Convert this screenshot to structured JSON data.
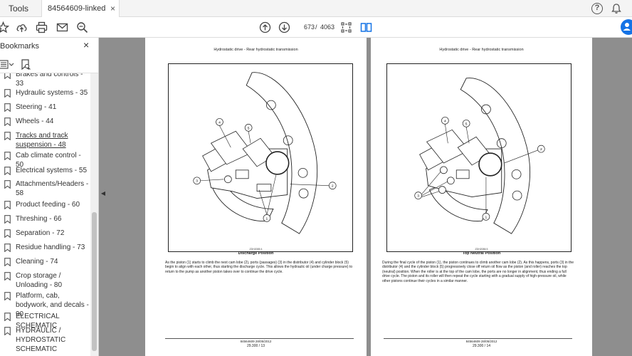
{
  "tabs": {
    "tools": "Tools",
    "document": "84564609-linked pd...",
    "close": "×"
  },
  "toolbar": {
    "current_page": "673",
    "separator": "/",
    "total_pages": "4063"
  },
  "sidebar": {
    "title": "Bookmarks",
    "close": "×",
    "items": [
      {
        "label": "Brakes and controls - 33"
      },
      {
        "label": "Hydraulic systems - 35"
      },
      {
        "label": "Steering - 41"
      },
      {
        "label": "Wheels - 44"
      },
      {
        "label": "Tracks and track suspension - 48"
      },
      {
        "label": "Cab climate control - 50"
      },
      {
        "label": "Electrical systems - 55"
      },
      {
        "label": "Attachments/Headers - 58"
      },
      {
        "label": "Product feeding - 60"
      },
      {
        "label": "Threshing - 66"
      },
      {
        "label": "Separation - 72"
      },
      {
        "label": "Residue handling - 73"
      },
      {
        "label": "Cleaning - 74"
      },
      {
        "label": "Crop storage / Unloading - 80"
      },
      {
        "label": "Platform, cab, bodywork, and decals - 90"
      },
      {
        "label": "ELECTRICAL SCHEMATIC"
      },
      {
        "label": "HYDRAULIC / HYDROSTATIC SCHEMATIC"
      }
    ]
  },
  "pages": [
    {
      "header": "Hydrostatic drive - Rear hydrostatic transmission",
      "fig_small": "ZDH2085 4",
      "caption": "Discharge Position",
      "body": "As the piston (1) starts to climb the next cam lobe (2), ports (passages) (3) in the distributor (4) and cylinder block (5) begin to align with each other, thus starting the discharge cycle. This allows the hydraulic oil (under charge pressure) to return to the pump as another piston takes over to continue the drive cycle.",
      "footer_ref": "84564609 28/05/2012",
      "footer_page": "29.300 / 13",
      "callouts": [
        "1",
        "2",
        "3",
        "4",
        "5"
      ]
    },
    {
      "header": "Hydrostatic drive - Rear hydrostatic transmission",
      "fig_small": "ZDH2086 5",
      "caption": "Top Neutral Position",
      "body": "During the final cycle of the piston (1), the piston continues to climb another cam lobe (2). As this happens, ports (3) in the distributor (4) and the cylinder block (5) progressively close off return oil flow as the piston (and roller) reaches the top (neutral) position. When the roller is at the top of the cam lobe, the ports are no longer in alignment, thus ending a full drive cycle. The piston and its roller will then repeat the cycle starting with a gradual supply of high-pressure oil, while other pistons continue their cycles in a similar manner.",
      "footer_ref": "84564609 28/05/2012",
      "footer_page": "29.300 / 14",
      "callouts": [
        "1",
        "2",
        "3",
        "4",
        "5"
      ]
    }
  ]
}
